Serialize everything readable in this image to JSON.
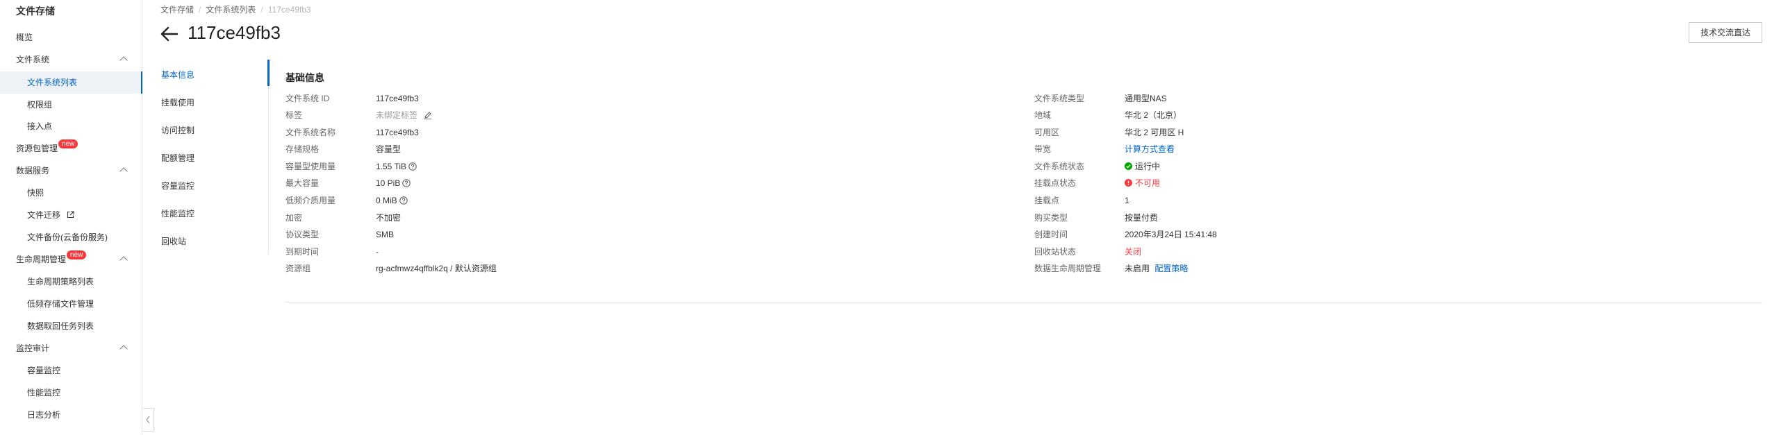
{
  "sidebar": {
    "title": "文件存储",
    "items": [
      {
        "label": "概览",
        "level": "top"
      },
      {
        "label": "文件系统",
        "level": "top",
        "expanded": true
      },
      {
        "label": "文件系统列表",
        "level": "sub",
        "active": true
      },
      {
        "label": "权限组",
        "level": "sub"
      },
      {
        "label": "接入点",
        "level": "sub"
      },
      {
        "label": "资源包管理",
        "level": "top",
        "badge": "new"
      },
      {
        "label": "数据服务",
        "level": "top",
        "expanded": true
      },
      {
        "label": "快照",
        "level": "sub"
      },
      {
        "label": "文件迁移",
        "level": "sub",
        "external": true
      },
      {
        "label": "文件备份(云备份服务)",
        "level": "sub"
      },
      {
        "label": "生命周期管理",
        "level": "top",
        "badge": "new",
        "expanded": true
      },
      {
        "label": "生命周期策略列表",
        "level": "sub"
      },
      {
        "label": "低频存储文件管理",
        "level": "sub"
      },
      {
        "label": "数据取回任务列表",
        "level": "sub"
      },
      {
        "label": "监控审计",
        "level": "top",
        "expanded": true
      },
      {
        "label": "容量监控",
        "level": "sub"
      },
      {
        "label": "性能监控",
        "level": "sub"
      },
      {
        "label": "日志分析",
        "level": "sub"
      }
    ]
  },
  "breadcrumb": [
    "文件存储",
    "文件系统列表",
    "117ce49fb3"
  ],
  "page_title": "117ce49fb3",
  "header_button": "技术交流直达",
  "subnav": [
    {
      "label": "基本信息",
      "active": true
    },
    {
      "label": "挂载使用"
    },
    {
      "label": "访问控制"
    },
    {
      "label": "配额管理"
    },
    {
      "label": "容量监控"
    },
    {
      "label": "性能监控"
    },
    {
      "label": "回收站"
    }
  ],
  "basic_info": {
    "title": "基础信息",
    "left": [
      {
        "key": "文件系统 ID",
        "value": "117ce49fb3"
      },
      {
        "key": "标签",
        "value": "未绑定标签",
        "muted": true,
        "icon": "edit-icon"
      },
      {
        "key": "文件系统名称",
        "value": "117ce49fb3"
      },
      {
        "key": "存储规格",
        "value": "容量型"
      },
      {
        "key": "容量型使用量",
        "value": "1.55 TiB",
        "icon": "help-icon"
      },
      {
        "key": "最大容量",
        "value": "10 PiB",
        "icon": "help-icon"
      },
      {
        "key": "低频介质用量",
        "value": "0 MiB",
        "icon": "help-icon"
      },
      {
        "key": "加密",
        "value": "不加密"
      },
      {
        "key": "协议类型",
        "value": "SMB"
      },
      {
        "key": "到期时间",
        "value": "-"
      },
      {
        "key": "资源组",
        "value": "rg-acfmwz4qffblk2q / 默认资源组"
      }
    ],
    "right": [
      {
        "key": "文件系统类型",
        "value": "通用型NAS"
      },
      {
        "key": "地域",
        "value": "华北 2（北京）"
      },
      {
        "key": "可用区",
        "value": "华北 2 可用区 H"
      },
      {
        "key": "带宽",
        "value": "计算方式查看",
        "link": true
      },
      {
        "key": "文件系统状态",
        "value": "运行中",
        "status": "ok"
      },
      {
        "key": "挂载点状态",
        "value": "不可用",
        "status": "error"
      },
      {
        "key": "挂载点",
        "value": "1"
      },
      {
        "key": "购买类型",
        "value": "按量付费"
      },
      {
        "key": "创建时间",
        "value": "2020年3月24日 15:41:48"
      },
      {
        "key": "回收站状态",
        "value": "关闭",
        "status_text": "red"
      },
      {
        "key": "数据生命周期管理",
        "value": "未启用",
        "action": "配置策略"
      }
    ]
  },
  "colors": {
    "accent": "#0064c8",
    "danger": "#f6393d",
    "success": "#00a700",
    "badge": "#f6393d"
  }
}
